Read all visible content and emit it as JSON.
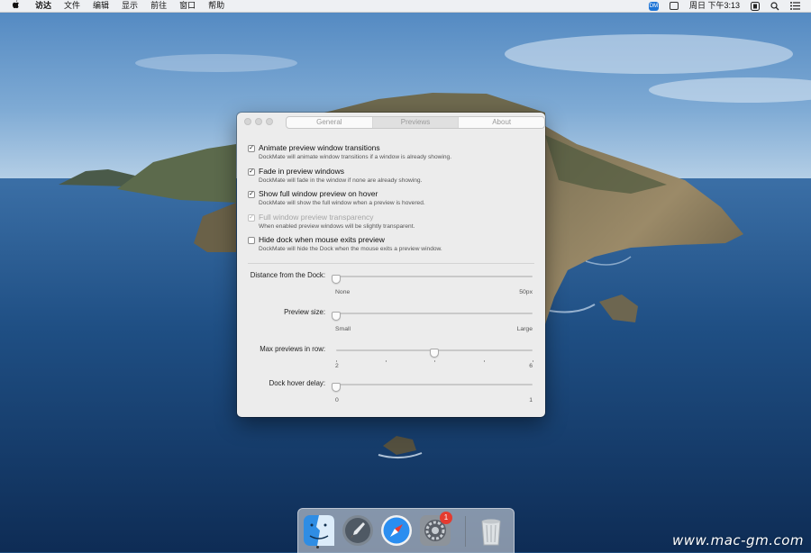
{
  "menubar": {
    "app_name": "访达",
    "menus": [
      "文件",
      "编辑",
      "显示",
      "前往",
      "窗口",
      "帮助"
    ],
    "clock": "周日 下午3:13",
    "status_badge": "DM"
  },
  "window": {
    "tabs": [
      {
        "label": "General",
        "active": false
      },
      {
        "label": "Previews",
        "active": true
      },
      {
        "label": "About",
        "active": false
      }
    ],
    "options": [
      {
        "title": "Animate preview window transitions",
        "desc": "DockMate will animate window transitions if a window is already showing.",
        "checked": true,
        "disabled": false
      },
      {
        "title": "Fade in preview windows",
        "desc": "DockMate will fade in the window if none are already showing.",
        "checked": true,
        "disabled": false
      },
      {
        "title": "Show full window preview on hover",
        "desc": "DockMate will show the full window when a preview is hovered.",
        "checked": true,
        "disabled": false
      },
      {
        "title": "Full window preview transparency",
        "desc": "When enabled preview windows will be slightly transparent.",
        "checked": true,
        "disabled": true
      },
      {
        "title": "Hide dock when mouse exits preview",
        "desc": "DockMate will hide the Dock when the mouse exits a preview window.",
        "checked": false,
        "disabled": false
      }
    ],
    "sliders": [
      {
        "label": "Distance from the Dock:",
        "min_label": "None",
        "max_label": "50px",
        "value": 0,
        "ticks": 0
      },
      {
        "label": "Preview size:",
        "min_label": "Small",
        "max_label": "Large",
        "value": 0,
        "ticks": 0
      },
      {
        "label": "Max previews in row:",
        "min_label": "2",
        "max_label": "6",
        "value": 0.5,
        "ticks": 5
      },
      {
        "label": "Dock hover delay:",
        "min_label": "0",
        "max_label": "1",
        "value": 0,
        "ticks": 0
      }
    ]
  },
  "dock": {
    "apps": [
      "finder-icon",
      "launchpad-icon",
      "safari-icon",
      "system-preferences-icon",
      "trash-icon"
    ],
    "system_preferences_badge": "1"
  },
  "watermark": "www.mac-gm.com"
}
